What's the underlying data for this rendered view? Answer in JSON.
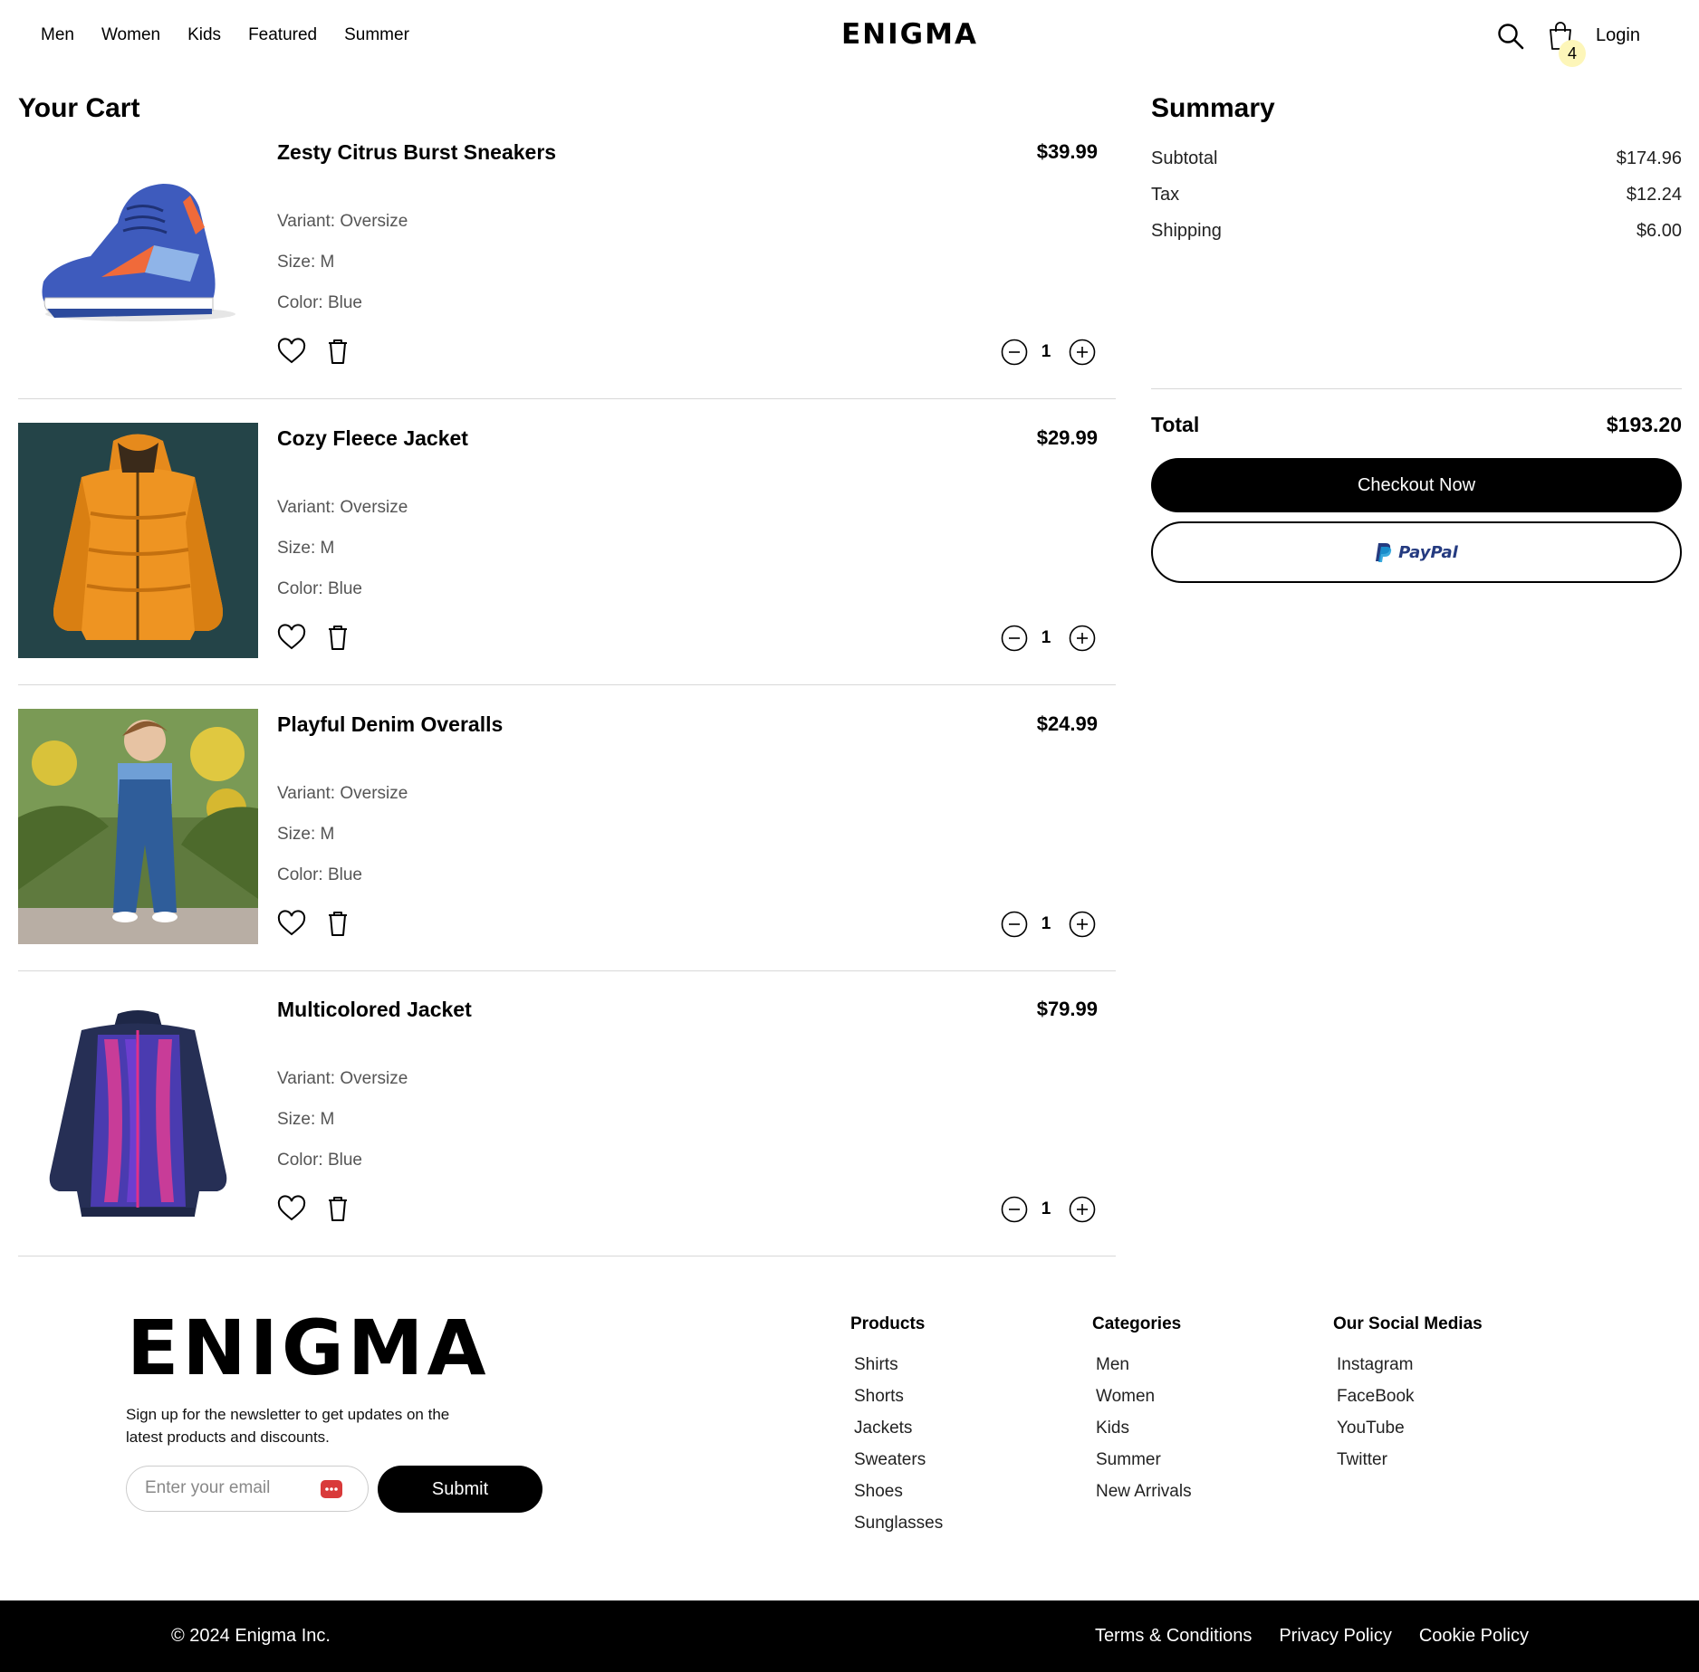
{
  "header": {
    "nav": [
      "Men",
      "Women",
      "Kids",
      "Featured",
      "Summer"
    ],
    "brand": "ENIGMA",
    "cart_count": "4",
    "login": "Login"
  },
  "cart": {
    "title": "Your Cart",
    "items": [
      {
        "name": "Zesty Citrus Burst Sneakers",
        "price": "$39.99",
        "variant": "Variant: Oversize",
        "size": "Size: M",
        "color": "Color: Blue",
        "qty": "1"
      },
      {
        "name": "Cozy Fleece Jacket",
        "price": "$29.99",
        "variant": "Variant: Oversize",
        "size": "Size: M",
        "color": "Color: Blue",
        "qty": "1"
      },
      {
        "name": "Playful Denim Overalls",
        "price": "$24.99",
        "variant": "Variant: Oversize",
        "size": "Size: M",
        "color": "Color: Blue",
        "qty": "1"
      },
      {
        "name": "Multicolored Jacket",
        "price": "$79.99",
        "variant": "Variant: Oversize",
        "size": "Size: M",
        "color": "Color: Blue",
        "qty": "1"
      }
    ]
  },
  "summary": {
    "title": "Summary",
    "subtotal_label": "Subtotal",
    "subtotal": "$174.96",
    "tax_label": "Tax",
    "tax": "$12.24",
    "shipping_label": "Shipping",
    "shipping": "$6.00",
    "total_label": "Total",
    "total": "$193.20",
    "checkout": "Checkout Now",
    "paypal": "PayPal"
  },
  "footer": {
    "brand": "ENIGMA",
    "newsletter": "Sign up for the newsletter to get updates on the latest products and discounts.",
    "email_placeholder": "Enter your email",
    "submit": "Submit",
    "columns": [
      {
        "title": "Products",
        "links": [
          "Shirts",
          "Shorts",
          "Jackets",
          "Sweaters",
          "Shoes",
          "Sunglasses"
        ]
      },
      {
        "title": "Categories",
        "links": [
          "Men",
          "Women",
          "Kids",
          "Summer",
          "New Arrivals"
        ]
      },
      {
        "title": "Our Social Medias",
        "links": [
          "Instagram",
          "FaceBook",
          "YouTube",
          "Twitter"
        ]
      }
    ],
    "copyright": "© 2024 Enigma Inc.",
    "legal": [
      "Terms & Conditions",
      "Privacy Policy",
      "Cookie Policy"
    ]
  },
  "colors": {
    "accent": "#000000",
    "badge": "#fdf6b9",
    "paypal_blue": "#253b80",
    "paypal_light": "#179bd7"
  }
}
